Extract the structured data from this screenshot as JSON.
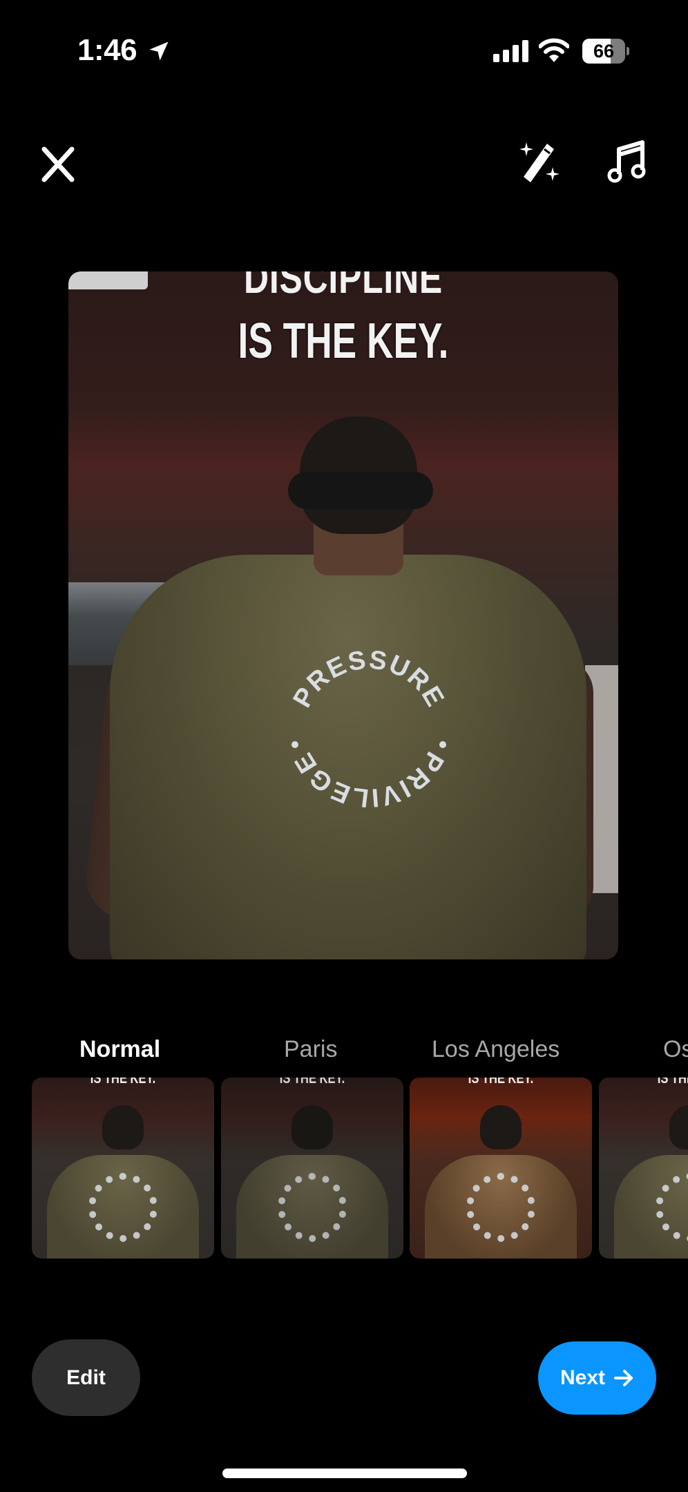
{
  "status_bar": {
    "time": "1:46",
    "location_icon": "location-arrow-icon",
    "signal_icon": "cellular-signal-icon",
    "wifi_icon": "wifi-icon",
    "battery_level": 66,
    "battery_text": "66"
  },
  "toolbar": {
    "close_icon": "close-icon",
    "magic_icon": "magic-wand-icon",
    "music_icon": "music-note-icon"
  },
  "photo": {
    "caption_line_1": "DISCIPLINE",
    "caption_line_2": "IS THE KEY.",
    "shirt_text_top": "PRESSURE",
    "shirt_text_bottom": "PRIVILEGE"
  },
  "filters": {
    "items": [
      {
        "label": "Normal",
        "active": true
      },
      {
        "label": "Paris",
        "active": false
      },
      {
        "label": "Los Angeles",
        "active": false
      },
      {
        "label": "Oslo",
        "active": false
      }
    ],
    "thumb_caption": "IS THE KEY."
  },
  "actions": {
    "edit_label": "Edit",
    "next_label": "Next",
    "next_icon": "arrow-right-icon",
    "accent_color": "#0a95ff"
  }
}
